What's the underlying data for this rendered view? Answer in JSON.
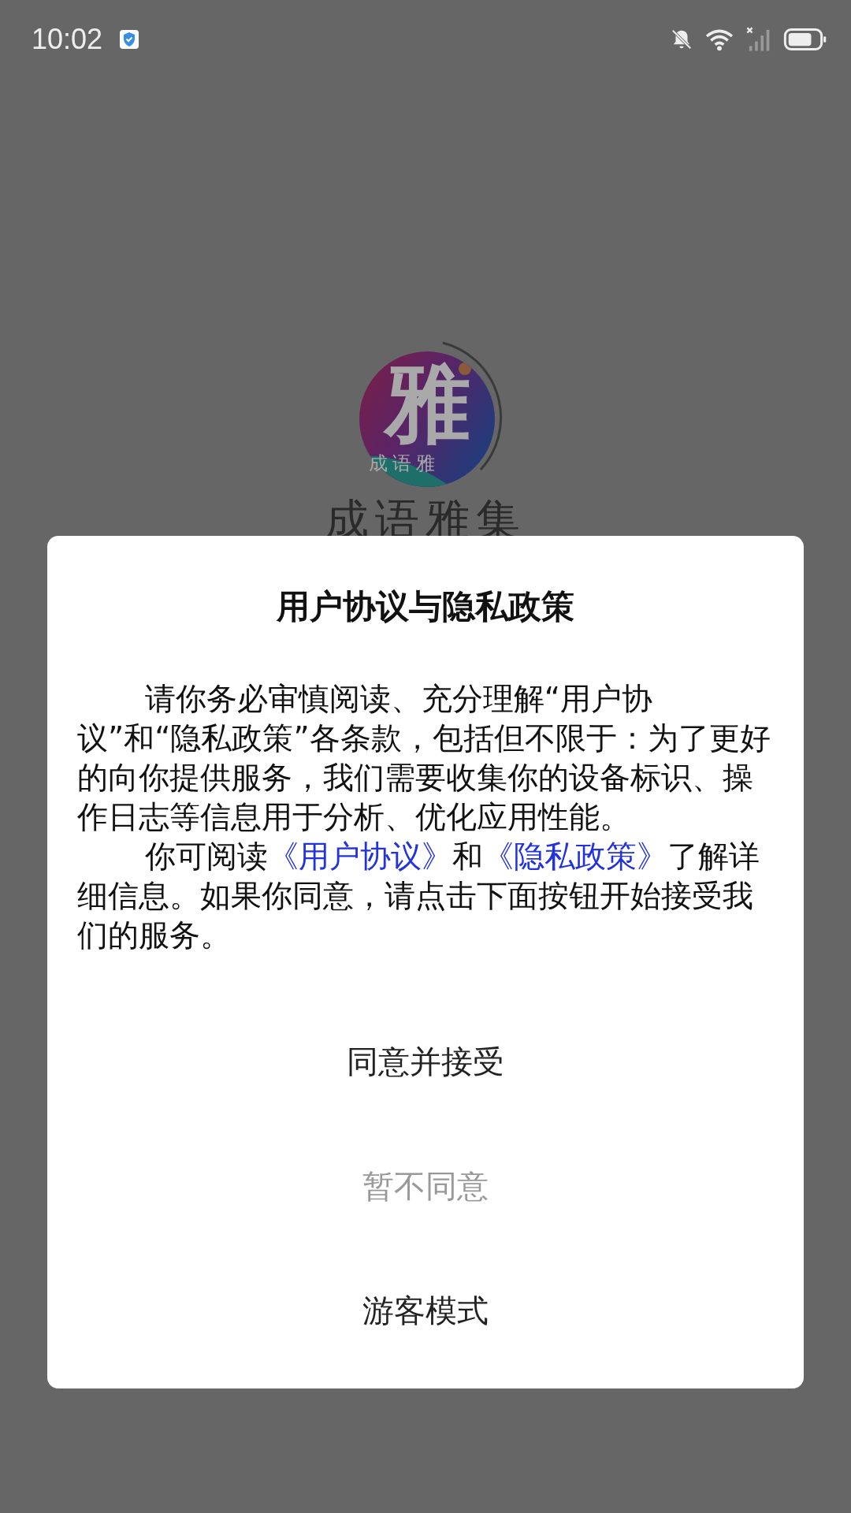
{
  "status_bar": {
    "time": "10:02"
  },
  "splash": {
    "logo_mark": "雅",
    "logo_caption": "成语雅",
    "app_name": "成语雅集"
  },
  "dialog": {
    "title": "用户协议与隐私政策",
    "paragraphs": [
      [
        {
          "kind": "text",
          "text": "请你务必审慎阅读、充分理解“用户协议”和“隐私政策”各条款，包括但不限于：为了更好的向你提供服务，我们需要收集你的设备标识、操作日志等信息用于分析、优化应用性能。"
        }
      ],
      [
        {
          "kind": "text",
          "text": "你可阅读"
        },
        {
          "kind": "link",
          "text": "《用户协议》"
        },
        {
          "kind": "text",
          "text": "和"
        },
        {
          "kind": "link",
          "text": "《隐私政策》"
        },
        {
          "kind": "text",
          "text": "了解详细信息。如果你同意，请点击下面按钮开始接受我们的服务。"
        }
      ]
    ],
    "buttons": [
      {
        "label": "同意并接受",
        "kind": "normal"
      },
      {
        "label": "暂不同意",
        "kind": "muted"
      },
      {
        "label": "游客模式",
        "kind": "normal"
      }
    ]
  }
}
